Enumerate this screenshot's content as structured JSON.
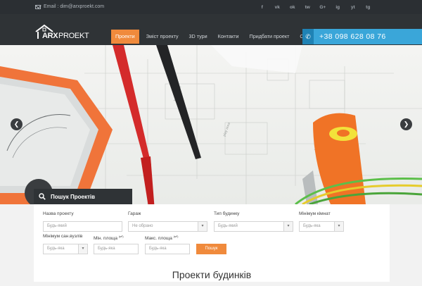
{
  "topbar": {
    "email_label": "Email : dim@arxproekt.com",
    "social": [
      "f",
      "vk",
      "ok",
      "tw",
      "G+",
      "ig",
      "yt",
      "tg"
    ]
  },
  "logo": {
    "arx": "ARX",
    "proekt": "PROEKT"
  },
  "menu": [
    {
      "label": "Проекти",
      "active": true
    },
    {
      "label": "Зміст проекту",
      "active": false
    },
    {
      "label": "3D тури",
      "active": false
    },
    {
      "label": "Контакти",
      "active": false
    },
    {
      "label": "Придбати проект",
      "active": false
    },
    {
      "label": "Статті",
      "active": false
    }
  ],
  "phone": {
    "icon": "phone-icon",
    "number": "+38 098 628 08 76"
  },
  "hero": {
    "prev_icon": "chevron-left-icon",
    "next_icon": "chevron-right-icon"
  },
  "search": {
    "tab_label": "Пошук Проектів",
    "fields": {
      "name": {
        "label": "Назва проекту",
        "placeholder": "Будь-який"
      },
      "garage": {
        "label": "Гараж",
        "value": "Не обрано"
      },
      "type": {
        "label": "Тип будинку",
        "value": "Будь-який"
      },
      "rooms": {
        "label": "Мінімум кімнат",
        "value": "Будь-яка"
      },
      "bathrooms": {
        "label": "Мінімум сан.вузлів",
        "value": "Будь-яка"
      },
      "min_area": {
        "label": "Мін. площа",
        "unit": "(м²)",
        "placeholder": "Будь-яка"
      },
      "max_area": {
        "label": "Макс. площа",
        "unit": "(м²)",
        "placeholder": "Будь-яка"
      }
    },
    "button_label": "Пошук"
  },
  "section": {
    "title": "Проекти будинків"
  }
}
